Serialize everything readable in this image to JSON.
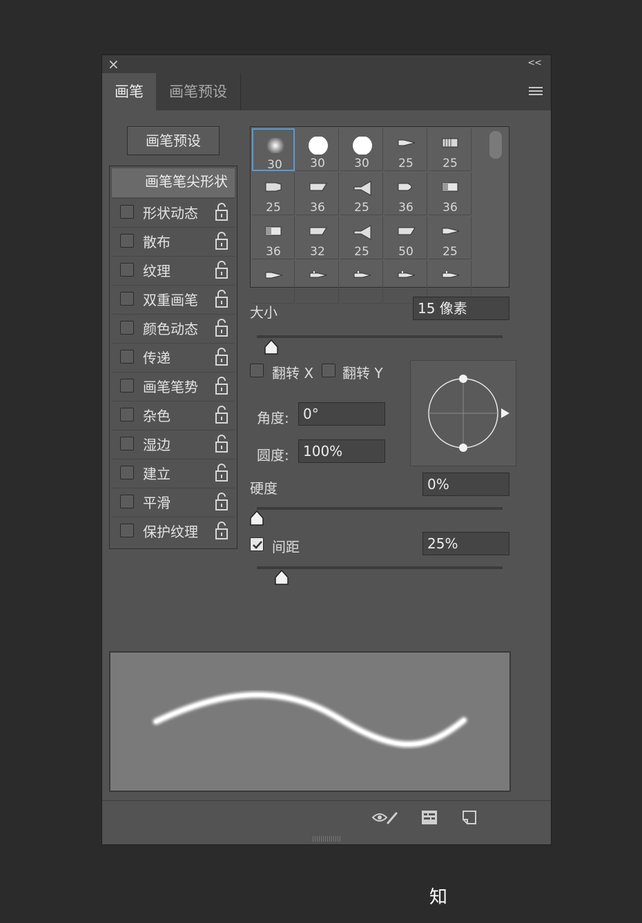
{
  "window": {
    "close_glyph": "×",
    "collapse_glyph": "<<"
  },
  "tabs": [
    {
      "label": "画笔"
    },
    {
      "label": "画笔预设"
    }
  ],
  "preset_button": "画笔预设",
  "sidebar": {
    "header": "画笔笔尖形状",
    "items": [
      {
        "label": "形状动态",
        "checked": false
      },
      {
        "label": "散布",
        "checked": false
      },
      {
        "label": "纹理",
        "checked": false
      },
      {
        "label": "双重画笔",
        "checked": false
      },
      {
        "label": "颜色动态",
        "checked": false
      },
      {
        "label": "传递",
        "checked": false
      },
      {
        "label": "画笔笔势",
        "checked": false
      },
      {
        "label": "杂色",
        "checked": false
      },
      {
        "label": "湿边",
        "checked": false
      },
      {
        "label": "建立",
        "checked": false
      },
      {
        "label": "平滑",
        "checked": false
      },
      {
        "label": "保护纹理",
        "checked": false
      }
    ]
  },
  "brush_grid": {
    "rows": [
      [
        {
          "size": "30",
          "tip": "soft-round-icon",
          "selected": true
        },
        {
          "size": "30",
          "tip": "hard-round-icon"
        },
        {
          "size": "30",
          "tip": "hard-round-icon"
        },
        {
          "size": "25",
          "tip": "pointed-brush-icon"
        },
        {
          "size": "25",
          "tip": "bristle-brush-icon"
        }
      ],
      [
        {
          "size": "25",
          "tip": "flat-brush-icon"
        },
        {
          "size": "36",
          "tip": "angled-brush-icon"
        },
        {
          "size": "25",
          "tip": "fan-brush-icon"
        },
        {
          "size": "36",
          "tip": "round-bristle-icon"
        },
        {
          "size": "36",
          "tip": "blunt-brush-icon"
        }
      ],
      [
        {
          "size": "36",
          "tip": "blunt-brush-icon"
        },
        {
          "size": "32",
          "tip": "angled-brush-icon"
        },
        {
          "size": "25",
          "tip": "fan-brush-icon"
        },
        {
          "size": "50",
          "tip": "angled-brush-icon"
        },
        {
          "size": "25",
          "tip": "pointed-brush-icon"
        }
      ],
      [
        {
          "size": "",
          "tip": "pointed-brush-icon"
        },
        {
          "size": "",
          "tip": "airbrush-icon"
        },
        {
          "size": "",
          "tip": "airbrush-icon"
        },
        {
          "size": "",
          "tip": "airbrush-icon"
        },
        {
          "size": "",
          "tip": "airbrush-icon"
        }
      ]
    ]
  },
  "size": {
    "label": "大小",
    "value": "15 像素",
    "slider_fraction": 0.06
  },
  "flip": {
    "x_label": "翻转 X",
    "y_label": "翻转 Y",
    "x_checked": false,
    "y_checked": false
  },
  "angle": {
    "label": "角度:",
    "value": "0°"
  },
  "roundness": {
    "label": "圆度:",
    "value": "100%"
  },
  "hardness": {
    "label": "硬度",
    "value": "0%",
    "slider_fraction": 0.0
  },
  "spacing": {
    "label": "间距",
    "value": "25%",
    "checked": true,
    "slider_fraction": 0.1
  },
  "bottom_icons": [
    "eye-brush-icon",
    "grid-panel-icon",
    "new-preset-icon"
  ],
  "footer_mark": "知",
  "colors": {
    "panel": "#535353",
    "header": "#3d3d3d",
    "accent": "#5a9bd5"
  }
}
